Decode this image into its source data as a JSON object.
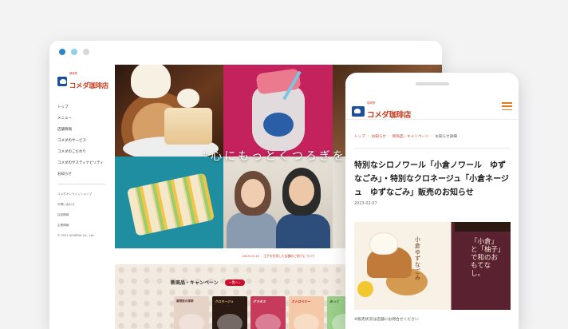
{
  "desktop": {
    "logo_text": "コメダ珈琲店",
    "logo_sub": "珈琲所",
    "nav": [
      "トップ",
      "メニュー",
      "店舗情報",
      "コメダのサービス",
      "コメダのこだわり",
      "コメダのサスティナビリティ",
      "お知らせ"
    ],
    "subnav": [
      "コメダオンラインショップ",
      "お問い合わせ",
      "採用情報",
      "企業情報",
      "© 2021 KOMEDA Co., Ltd."
    ],
    "tagline": "“心にもっとくつろぎを",
    "notice_date": "2023.03.15",
    "notice_text": "王子を利用した店舗のご紹介について",
    "news_title": "新商品・キャンペーン",
    "news_more": "一覧へ ›",
    "cards": [
      "春限定の抹茶",
      "クロネージュ",
      "グラタス",
      "ストロベリー",
      "あっと"
    ]
  },
  "mobile": {
    "logo_text": "コメダ珈琲店",
    "logo_sub": "珈琲所",
    "breadcrumbs": [
      "トップ",
      "お知らせ",
      "新商品・キャンペーン",
      "お知らせ詳細"
    ],
    "title": "特別なシロノワール「小倉ノワール　ゆずなごみ」・特別なクロネージュ「小倉ネージュ　ゆずなごみ」販売のお知らせ",
    "date": "2023.02.07",
    "banner_vtext": "小倉ゆずなごみ",
    "banner_noren": "「小倉」と「柚子」で和のおもてなし。",
    "note": "※販売状況は店舗にお問合せください"
  },
  "colors": {
    "accent": "#c83a1c",
    "brand_blue": "#1f4e9a",
    "menu_orange": "#e07a1e"
  }
}
